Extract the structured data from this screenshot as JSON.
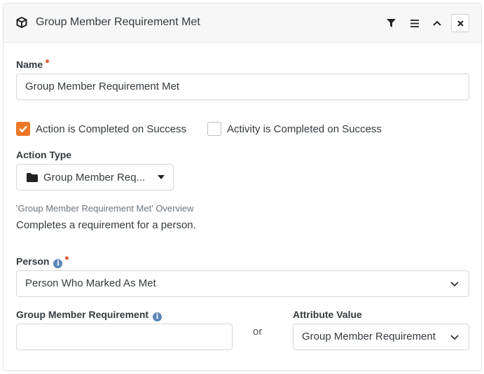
{
  "header": {
    "title": "Group Member Requirement Met",
    "icon": "cube-icon",
    "buttons": [
      "filter-icon",
      "bars-icon",
      "chevron-up-icon",
      "close-icon"
    ]
  },
  "name_field": {
    "label": "Name",
    "value": "Group Member Requirement Met"
  },
  "checkboxes": [
    {
      "label": "Action is Completed on Success",
      "checked": true
    },
    {
      "label": "Activity is Completed on Success",
      "checked": false
    }
  ],
  "action_type": {
    "label": "Action Type",
    "value": "Group Member Req...",
    "icon": "folder-icon"
  },
  "overview": {
    "title": "'Group Member Requirement Met' Overview",
    "description": "Completes a requirement for a person."
  },
  "person": {
    "label": "Person",
    "value": "Person Who Marked As Met"
  },
  "group_member_requirement": {
    "label": "Group Member Requirement",
    "value": ""
  },
  "or_label": "or",
  "attribute_value": {
    "label": "Attribute Value",
    "value": "Group Member Requirement"
  },
  "colors": {
    "accent": "#ee7624",
    "required": "#e25b3c",
    "info": "#5d86b8"
  }
}
